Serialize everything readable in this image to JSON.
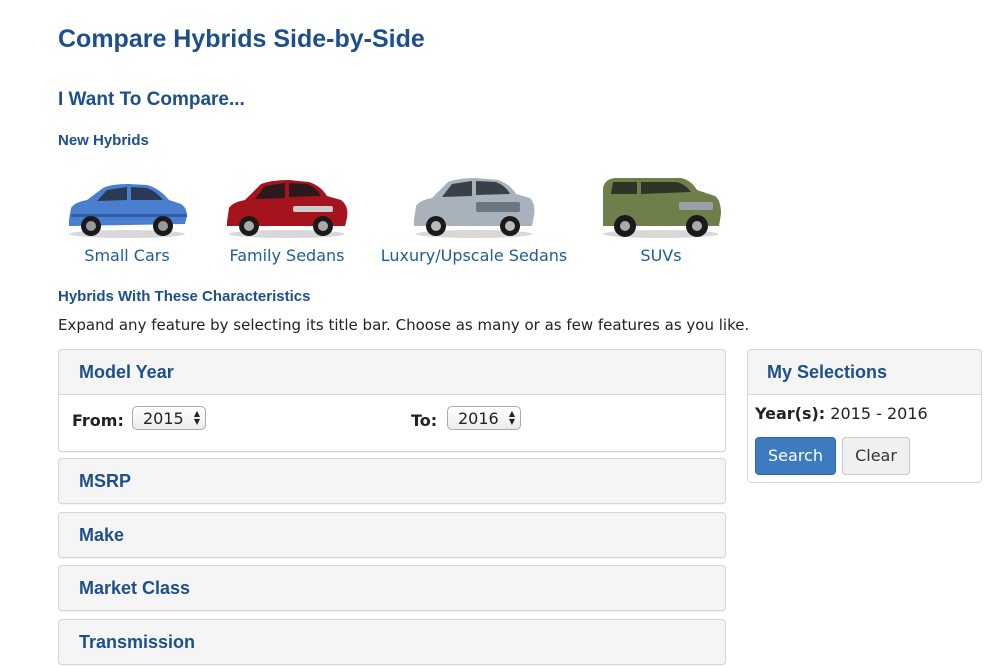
{
  "header": {
    "title": "Compare Hybrids Side-by-Side",
    "section_title": "I Want To Compare...",
    "new_hybrids_label": "New Hybrids",
    "characteristics_label": "Hybrids With These Characteristics",
    "instructions": "Expand any feature by selecting its title bar. Choose as many or as few features as you like."
  },
  "vehicles": [
    {
      "label": "Small Cars",
      "icon": "small-car-icon",
      "color": "#4a7fd0"
    },
    {
      "label": "Family Sedans",
      "icon": "family-sedan-icon",
      "color": "#a5141c"
    },
    {
      "label": "Luxury/Upscale Sedans",
      "icon": "luxury-sedan-icon",
      "color": "#a8b2bd"
    },
    {
      "label": "SUVs",
      "icon": "suv-icon",
      "color": "#6f7f4c"
    }
  ],
  "features": {
    "model_year": {
      "title": "Model Year",
      "from_label": "From:",
      "from_value": "2015",
      "to_label": "To:",
      "to_value": "2016"
    },
    "msrp": {
      "title": "MSRP"
    },
    "make": {
      "title": "Make"
    },
    "market_class": {
      "title": "Market Class"
    },
    "transmission": {
      "title": "Transmission"
    }
  },
  "selections": {
    "title": "My Selections",
    "year_label": "Year(s):",
    "year_value": "2015 - 2016",
    "search_label": "Search",
    "clear_label": "Clear"
  },
  "colors": {
    "heading": "#1c4f8c",
    "link": "#1f5c99",
    "primary_button": "#3c7bbf",
    "panel_bg": "#f5f5f5"
  }
}
